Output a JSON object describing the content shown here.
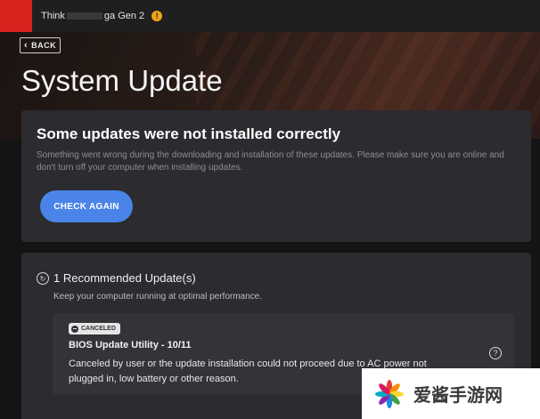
{
  "window": {
    "title": "Think",
    "title_tail": "ga Gen 2",
    "warning_icon": "exclamation-icon"
  },
  "header": {
    "back_label": "BACK",
    "page_title": "System Update"
  },
  "error_card": {
    "heading": "Some updates were not installed correctly",
    "description": "Something went wrong during the downloading and installation of these updates. Please make sure you are online and don't turn off your computer when installing updates.",
    "button_label": "CHECK AGAIN"
  },
  "recommended": {
    "heading": "1 Recommended Update(s)",
    "subheading": "Keep your computer running at optimal performance.",
    "items": [
      {
        "status": "CANCELED",
        "title": "BIOS Update Utility - 10/11",
        "description": "Canceled by user or the update installation could not proceed due to AC power not plugged in, low battery or other reason."
      }
    ]
  },
  "watermark": {
    "text": "爱酱手游网"
  },
  "colors": {
    "accent_button": "#4a84e8",
    "brand_red": "#d8231f",
    "warning": "#f0a21b",
    "card_bg": "#2b2b30"
  }
}
